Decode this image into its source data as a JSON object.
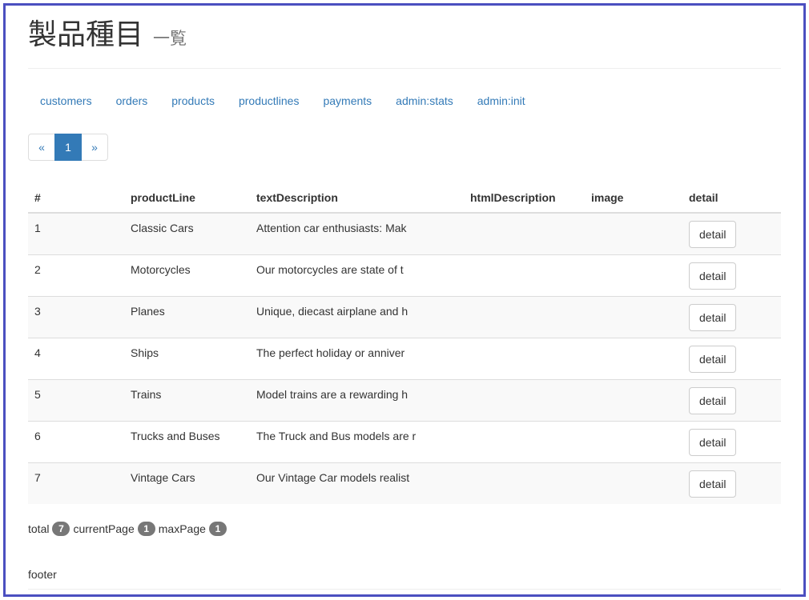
{
  "header": {
    "title": "製品種目",
    "subtitle": "一覧"
  },
  "nav": [
    {
      "label": "customers"
    },
    {
      "label": "orders"
    },
    {
      "label": "products"
    },
    {
      "label": "productlines"
    },
    {
      "label": "payments"
    },
    {
      "label": "admin:stats"
    },
    {
      "label": "admin:init"
    }
  ],
  "pagination": {
    "prev": "«",
    "current": "1",
    "next": "»"
  },
  "table": {
    "headers": [
      "#",
      "productLine",
      "textDescription",
      "htmlDescription",
      "image",
      "detail"
    ],
    "rows": [
      {
        "num": "1",
        "productLine": "Classic Cars",
        "textDescription": "Attention car enthusiasts: Mak",
        "htmlDescription": "",
        "image": "",
        "button": "detail"
      },
      {
        "num": "2",
        "productLine": "Motorcycles",
        "textDescription": "Our motorcycles are state of t",
        "htmlDescription": "",
        "image": "",
        "button": "detail"
      },
      {
        "num": "3",
        "productLine": "Planes",
        "textDescription": "Unique, diecast airplane and h",
        "htmlDescription": "",
        "image": "",
        "button": "detail"
      },
      {
        "num": "4",
        "productLine": "Ships",
        "textDescription": "The perfect holiday or anniver",
        "htmlDescription": "",
        "image": "",
        "button": "detail"
      },
      {
        "num": "5",
        "productLine": "Trains",
        "textDescription": "Model trains are a rewarding h",
        "htmlDescription": "",
        "image": "",
        "button": "detail"
      },
      {
        "num": "6",
        "productLine": "Trucks and Buses",
        "textDescription": "The Truck and Bus models are r",
        "htmlDescription": "",
        "image": "",
        "button": "detail"
      },
      {
        "num": "7",
        "productLine": "Vintage Cars",
        "textDescription": "Our Vintage Car models realist",
        "htmlDescription": "",
        "image": "",
        "button": "detail"
      }
    ]
  },
  "summary": {
    "total_label": "total",
    "total": "7",
    "current_label": "currentPage",
    "current": "1",
    "max_label": "maxPage",
    "max": "1"
  },
  "footer": {
    "text": "footer"
  },
  "colors": {
    "link": "#337ab7",
    "border": "#4b4fc0",
    "badge": "#777777"
  }
}
